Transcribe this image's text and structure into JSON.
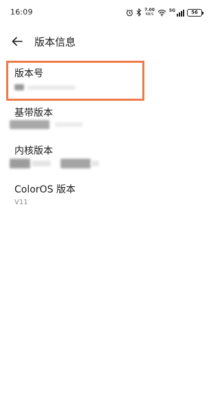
{
  "status_bar": {
    "time": "16:09",
    "speed_value": "7.00",
    "speed_unit": "KB/S",
    "signal_label": "5G",
    "battery": "56"
  },
  "header": {
    "title": "版本信息",
    "back_icon": "back-arrow-icon"
  },
  "items": [
    {
      "label": "版本号",
      "value": ""
    },
    {
      "label": "基带版本",
      "value": ""
    },
    {
      "label": "内核版本",
      "value": ""
    },
    {
      "label": "ColorOS 版本",
      "value": "V11"
    }
  ],
  "colors": {
    "highlight": "#ee7a4b",
    "label_text": "#1a1a1a",
    "value_text": "#8a8a8a"
  }
}
